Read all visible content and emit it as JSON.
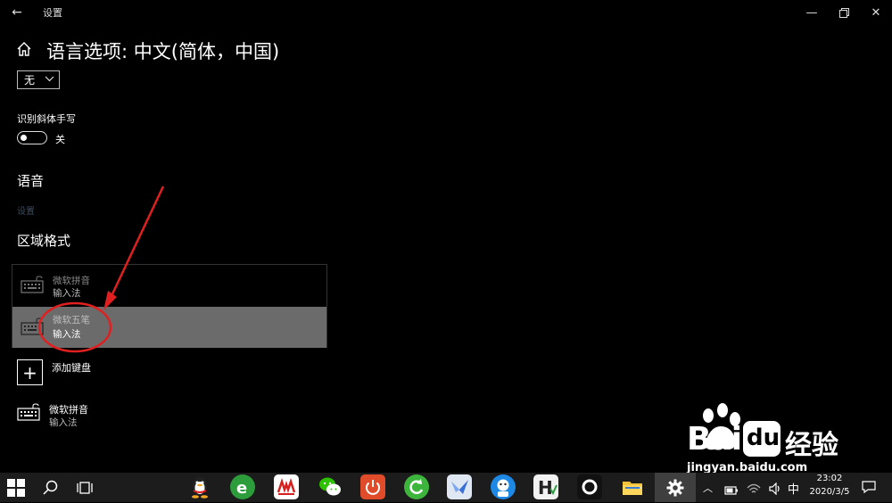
{
  "window": {
    "title": "设置"
  },
  "header": {
    "title": "语言选项: 中文(简体，中国)"
  },
  "dropdown": {
    "value": "无"
  },
  "handwriting": {
    "label": "识别斜体手写",
    "state": "关"
  },
  "speech": {
    "heading": "语音",
    "link": "设置"
  },
  "region": {
    "heading": "区域格式"
  },
  "ime_list": [
    {
      "name": "微软拼音",
      "sub": "输入法"
    },
    {
      "name": "微软五笔",
      "sub": "输入法"
    }
  ],
  "add_keyboard": {
    "label": "添加键盘"
  },
  "keyboard_item": {
    "name": "微软拼音",
    "sub": "输入法"
  },
  "tray": {
    "ime": "中",
    "time": "23:02",
    "date": "2020/3/5"
  },
  "watermark": {
    "brand": "Bai",
    "du": "du",
    "cn": "经验",
    "url": "jingyan.baidu.com"
  },
  "colors": {
    "background": "#000000",
    "selected_row": "#6b6b6b",
    "annotation": "#e02020",
    "taskbar": "#1c1c1c"
  }
}
